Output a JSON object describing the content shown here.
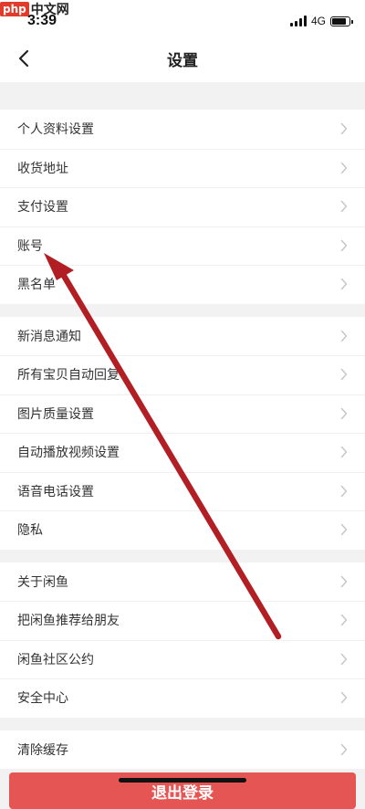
{
  "watermark": {
    "badge": "php",
    "text": "中文网"
  },
  "status_bar": {
    "time": "3:39",
    "network": "4G"
  },
  "nav": {
    "title": "设置"
  },
  "groups": [
    {
      "items": [
        {
          "label": "个人资料设置"
        },
        {
          "label": "收货地址"
        },
        {
          "label": "支付设置"
        },
        {
          "label": "账号"
        },
        {
          "label": "黑名单"
        }
      ]
    },
    {
      "items": [
        {
          "label": "新消息通知"
        },
        {
          "label": "所有宝贝自动回复"
        },
        {
          "label": "图片质量设置"
        },
        {
          "label": "自动播放视频设置"
        },
        {
          "label": "语音电话设置"
        },
        {
          "label": "隐私"
        }
      ]
    },
    {
      "items": [
        {
          "label": "关于闲鱼"
        },
        {
          "label": "把闲鱼推荐给朋友"
        },
        {
          "label": "闲鱼社区公约"
        },
        {
          "label": "安全中心"
        }
      ]
    },
    {
      "items": [
        {
          "label": "清除缓存"
        }
      ]
    }
  ],
  "logout": {
    "label": "退出登录"
  },
  "colors": {
    "annotation": "#b11f24",
    "logout_bg": "#e45553"
  },
  "icons": {
    "back": "chevron-left-icon",
    "row": "chevron-right-icon",
    "signal": "signal-bars-icon",
    "battery": "battery-icon"
  }
}
